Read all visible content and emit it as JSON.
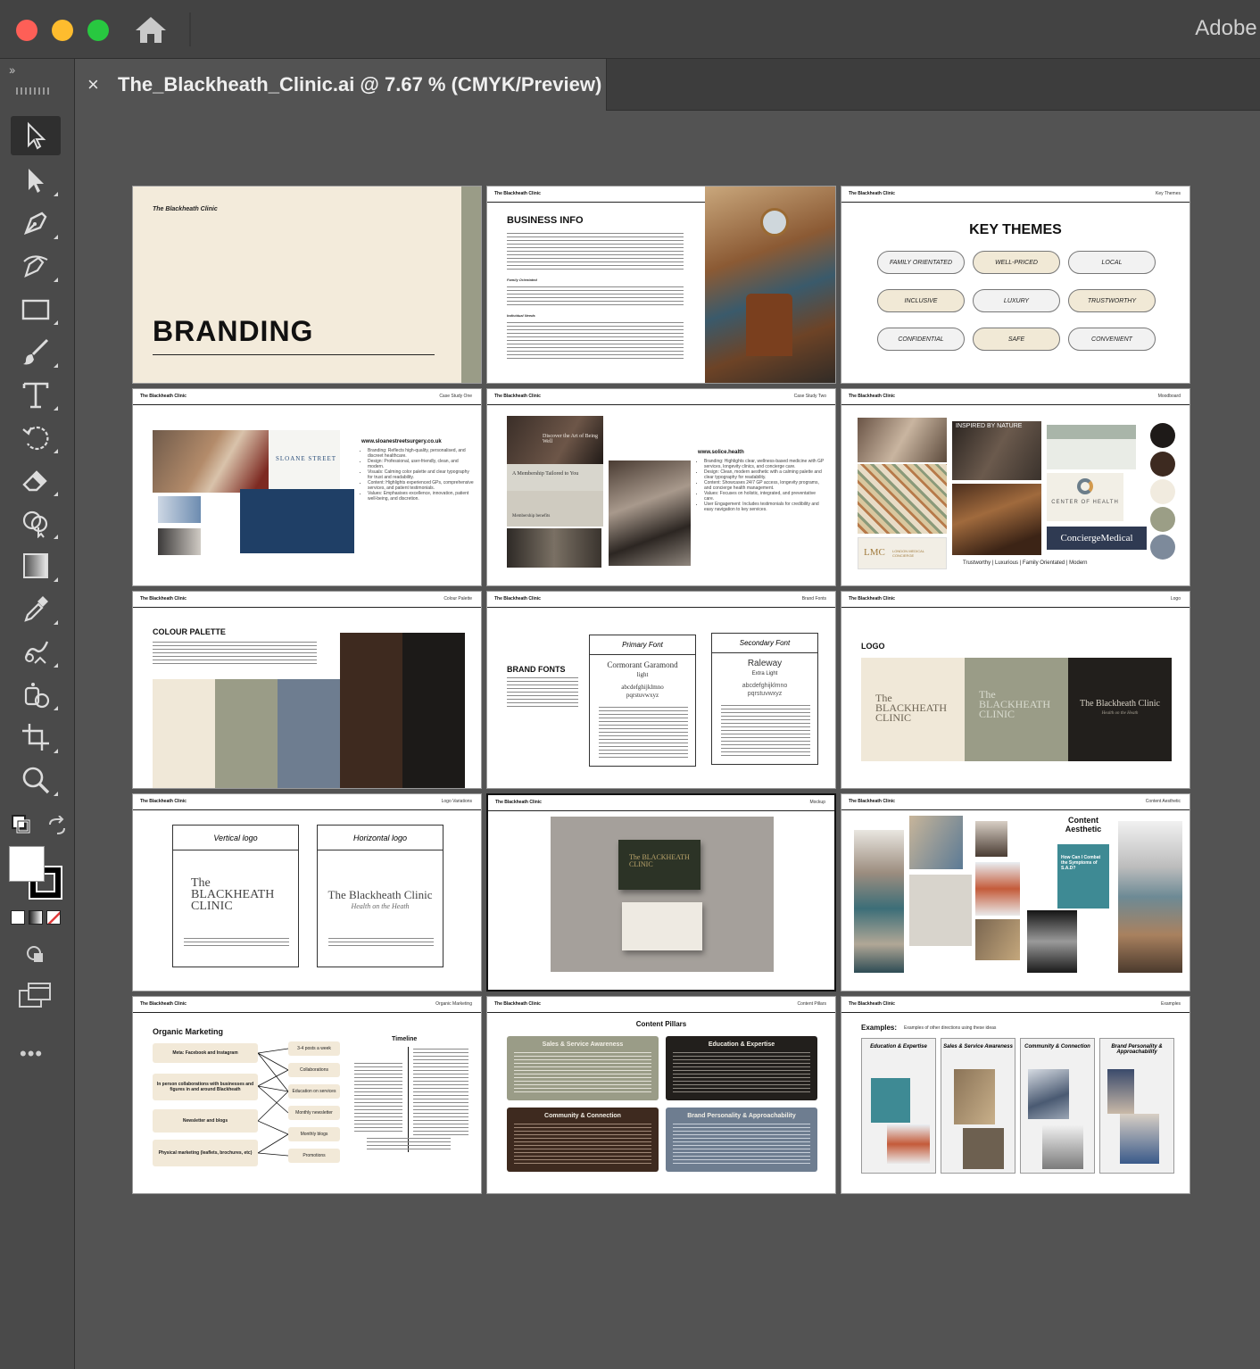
{
  "titlebar": {
    "app_name": "Adobe I"
  },
  "tab": {
    "close": "×",
    "title": "The_Blackheath_Clinic.ai @ 7.67 % (CMYK/Preview)"
  },
  "tools": [
    "selection",
    "direct-selection",
    "pen",
    "curvature",
    "rectangle",
    "paintbrush",
    "type",
    "rotate",
    "eraser",
    "shape-builder",
    "gradient",
    "eyedropper",
    "blend",
    "symbol-sprayer",
    "artboard",
    "zoom"
  ],
  "toolpanel": {
    "collapse": "››",
    "more": "•••"
  },
  "colors": {
    "fill": "#ffffff",
    "stroke": "#000000",
    "red_slash": "#e03a3a"
  },
  "artboards": {
    "branding": {
      "brand": "The Blackheath Clinic",
      "title": "BRANDING"
    },
    "business": {
      "header": "The Blackheath Clinic",
      "title": "BUSINESS INFO",
      "sub1": "Family Orientated",
      "sub2": "Individual Needs"
    },
    "themes": {
      "header": "The Blackheath Clinic",
      "header_r": "Key Themes",
      "title": "KEY THEMES",
      "pills": [
        "FAMILY ORIENTATED",
        "WELL-PRICED",
        "LOCAL",
        "INCLUSIVE",
        "LUXURY",
        "TRUSTWORTHY",
        "CONFIDENTIAL",
        "SAFE",
        "CONVENIENT"
      ]
    },
    "sloane": {
      "header": "The Blackheath Clinic",
      "header_r": "Case Study One",
      "url": "www.sloanestreetsurgery.co.uk",
      "logo": "SLOANE STREET",
      "bullets": [
        "Branding: Reflects high-quality, personalised, and discreet healthcare.",
        "Design: Professional, user-friendly, clean, and modern.",
        "Visuals: Calming color palette and clear typography for trust and readability.",
        "Content: Highlights experienced GPs, comprehensive services, and patient testimonials.",
        "Values: Emphasises excellence, innovation, patient well-being, and discretion."
      ]
    },
    "solice": {
      "header": "The Blackheath Clinic",
      "header_r": "Case Study Two",
      "url": "www.solice.health",
      "hero": "Discover the Art of Being Well",
      "sub": "A Membership Tailored to You",
      "benefits": "Membership benefits",
      "bullets": [
        "Branding: Highlights clear, wellness-based medicine with GP services, longevity clinics, and concierge care.",
        "Design: Clean, modern aesthetic with a calming palette and clear typography for readability.",
        "Content: Showcases 24/7 GP access, longevity programs, and concierge health management.",
        "Values: Focuses on holistic, integrated, and preventative care.",
        "User Engagement: Includes testimonials for credibility and easy navigation to key services."
      ]
    },
    "moodboard": {
      "header": "The Blackheath Clinic",
      "header_r": "Moodboard",
      "inspired": "INSPIRED BY NATURE",
      "center": "CENTER OF HEALTH",
      "lmc": "LMC",
      "lmc_sub": "LONDON MEDICAL CONCIERGE",
      "concierge": "ConciergeMedical",
      "caption": "Trustworthy | Luxurious | Family Orientated | Modern",
      "swatches": [
        "#1e1a18",
        "#3d2a20",
        "#f1ebdf",
        "#9b9e86",
        "#7d8a9b"
      ]
    },
    "palette": {
      "header": "The Blackheath Clinic",
      "header_r": "Colour Palette",
      "title": "COLOUR PALETTE",
      "colors": [
        "#f0e8d8",
        "#9a9c87",
        "#6e7d90",
        "#3e2a1f",
        "#1c1a18"
      ]
    },
    "fonts": {
      "header": "The Blackheath Clinic",
      "header_r": "Brand Fonts",
      "title": "BRAND FONTS",
      "primary_label": "Primary Font",
      "primary_name": "Cormorant Garamond",
      "primary_weight": "light",
      "primary_sample": "abcdefghijklmno pqrstuvwxyz",
      "secondary_label": "Secondary Font",
      "secondary_name": "Raleway",
      "secondary_weight": "Extra Light",
      "secondary_sample": "abcdefghijklmno pqrstuvwxyz"
    },
    "logo": {
      "header": "The Blackheath Clinic",
      "header_r": "Logo",
      "title": "LOGO",
      "v1": "The BLACKHEATH CLINIC",
      "v2": "The BLACKHEATH CLINIC",
      "v3": "The Blackheath Clinic",
      "v3_sub": "Health on the Heath",
      "colors": [
        "#f0e8d8",
        "#9a9c87",
        "#221f1c"
      ]
    },
    "logo_variations": {
      "header": "The Blackheath Clinic",
      "header_r": "Logo Variations",
      "vertical_label": "Vertical logo",
      "vertical_logo": "The BLACKHEATH CLINIC",
      "horizontal_label": "Horizontal logo",
      "horizontal_logo": "The Blackheath Clinic",
      "horizontal_sub": "Health on the Heath"
    },
    "mockup": {
      "header": "The Blackheath Clinic",
      "header_r": "Mockup",
      "card": "The BLACKHEATH CLINIC"
    },
    "content_aesthetic": {
      "header": "The Blackheath Clinic",
      "header_r": "Content Aesthetic",
      "title": "Content Aesthetic",
      "teal_card": "How Can I Combat the Symptoms of S.A.D?"
    },
    "marketing": {
      "header": "The Blackheath Clinic",
      "header_r": "Organic Marketing",
      "title": "Organic Marketing",
      "left": [
        "Meta: Facebook and Instagram",
        "In person collaborations with businesses and figures in and around Blackheath",
        "Newsletter and blogs",
        "Physical marketing (leaflets, brochures, etc)"
      ],
      "mid": [
        "3-4 posts a week",
        "Collaborations",
        "Education on services",
        "Monthly newsletter",
        "Monthly blogs",
        "Promotions"
      ],
      "timeline": "Timeline"
    },
    "pillars": {
      "header": "The Blackheath Clinic",
      "header_r": "Content Pillars",
      "title": "Content Pillars",
      "items": [
        "Sales & Service Awareness",
        "Education & Expertise",
        "Community & Connection",
        "Brand Personality & Approachability"
      ]
    },
    "examples": {
      "header": "The Blackheath Clinic",
      "header_r": "Examples",
      "title": "Examples:",
      "subtitle": "Examples of other directions using these ideas",
      "cols": [
        "Education & Expertise",
        "Sales & Service Awareness",
        "Community & Connection",
        "Brand Personality & Approachability"
      ]
    }
  }
}
